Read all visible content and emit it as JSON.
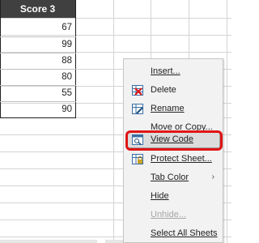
{
  "sheet": {
    "column_header": "Score 3",
    "scores": [
      "67",
      "99",
      "88",
      "80",
      "55",
      "90"
    ]
  },
  "context_menu": {
    "items": [
      {
        "label": "Insert...",
        "icon": "insert-sheet-icon",
        "enabled": true
      },
      {
        "label": "Delete",
        "icon": "delete-sheet-icon",
        "enabled": true
      },
      {
        "label": "Rename",
        "icon": "rename-sheet-icon",
        "enabled": true
      },
      {
        "label": "Move or Copy...",
        "icon": "",
        "enabled": true
      },
      {
        "label": "View Code",
        "icon": "view-code-icon",
        "enabled": true,
        "highlighted": true
      },
      {
        "label": "Protect Sheet...",
        "icon": "protect-sheet-icon",
        "enabled": true
      },
      {
        "label": "Tab Color",
        "icon": "",
        "enabled": true,
        "submenu": true
      },
      {
        "label": "Hide",
        "icon": "",
        "enabled": true
      },
      {
        "label": "Unhide...",
        "icon": "",
        "enabled": false
      },
      {
        "label": "Select All Sheets",
        "icon": "",
        "enabled": true
      }
    ],
    "highlight_color": "#e01515",
    "submenu_arrow": "›"
  }
}
